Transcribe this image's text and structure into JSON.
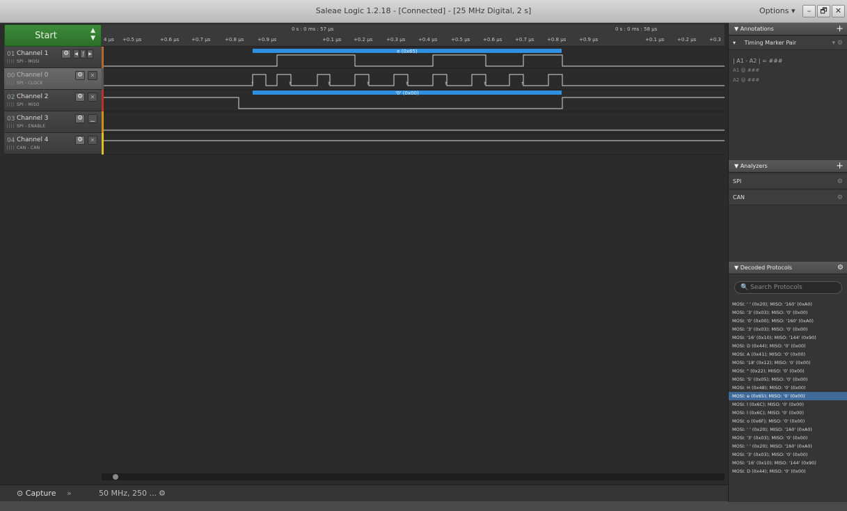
{
  "window": {
    "title": "Saleae Logic 1.2.18 - [Connected] - [25 MHz Digital, 2 s]",
    "options": "Options ▾",
    "minimize": "–",
    "restore": "🗗",
    "close": "✕"
  },
  "start": {
    "label": "Start"
  },
  "ruler": {
    "segment1": "0 s : 0 ms : 57 µs",
    "segment2": "0 s : 0 ms : 58 µs",
    "ticks_left": [
      "4 µs",
      "+0.5 µs",
      "+0.6 µs",
      "+0.7 µs",
      "+0.8 µs",
      "+0.9 µs"
    ],
    "ticks_mid": [
      "+0.1 µs",
      "+0.2 µs",
      "+0.3 µs",
      "+0.4 µs",
      "+0.5 µs",
      "+0.6 µs",
      "+0.7 µs",
      "+0.8 µs",
      "+0.9 µs"
    ],
    "ticks_right": [
      "+0.1 µs",
      "+0.2 µs",
      "+0.3"
    ]
  },
  "channels": [
    {
      "num": "01",
      "name": "Channel 1",
      "sub": "SPI - MOSI",
      "color": "#b06a2a"
    },
    {
      "num": "00",
      "name": "Channel 0",
      "sub": "SPI - CLOCK",
      "color": "#555555"
    },
    {
      "num": "02",
      "name": "Channel 2",
      "sub": "SPI - MISO",
      "color": "#c0302a"
    },
    {
      "num": "03",
      "name": "Channel 3",
      "sub": "SPI - ENABLE",
      "color": "#d0901a"
    },
    {
      "num": "04",
      "name": "Channel 4",
      "sub": "CAN - CAN",
      "color": "#e0c020"
    }
  ],
  "decodes": {
    "mosi": "e (0x65)",
    "miso": "'0' (0x00)"
  },
  "annotations": {
    "header": "▼  Annotations",
    "marker": "Timing Marker Pair",
    "line1": "| A1 - A2 | = ###",
    "line2": "A1  @  ###",
    "line3": "A2  @  ###"
  },
  "analyzers": {
    "header": "▼  Analyzers",
    "items": [
      "SPI",
      "CAN"
    ]
  },
  "decoded": {
    "header": "▼  Decoded Protocols",
    "search_placeholder": "🔍 Search Protocols",
    "items": [
      "MOSI: ' ' (0x20);  MISO: '160' (0xA0)",
      "MOSI: '3' (0x03);  MISO: '0' (0x00)",
      "MOSI: '0' (0x00);  MISO: '160' (0xA0)",
      "MOSI: '3' (0x03);  MISO: '0' (0x00)",
      "MOSI: '16' (0x10);  MISO: '144' (0x90)",
      "MOSI: D (0x44);  MISO: '0' (0x00)",
      "MOSI: A (0x41);  MISO: '0' (0x00)",
      "MOSI: '18' (0x12);  MISO: '0' (0x00)",
      "MOSI: \" (0x22);  MISO: '0' (0x00)",
      "MOSI: '5' (0x05);  MISO: '0' (0x00)",
      "MOSI: H (0x48);  MISO: '0' (0x00)",
      "MOSI: e (0x65);  MISO: '0' (0x00)",
      "MOSI: l (0x6C);  MISO: '0' (0x00)",
      "MOSI: l (0x6C);  MISO: '0' (0x00)",
      "MOSI: o (0x6F);  MISO: '0' (0x00)",
      "MOSI: ' ' (0x20);  MISO: '160' (0xA0)",
      "MOSI: '3' (0x03);  MISO: '0' (0x00)",
      "MOSI: ' ' (0x20);  MISO: '160' (0xA0)",
      "MOSI: '3' (0x03);  MISO: '0' (0x00)",
      "MOSI: '16' (0x10);  MISO: '144' (0x90)",
      "MOSI: D (0x44);  MISO: '0' (0x00)"
    ],
    "highlight_index": 11
  },
  "bottom": {
    "capture": "Capture",
    "rate": "50 MHz, 250 ..."
  }
}
